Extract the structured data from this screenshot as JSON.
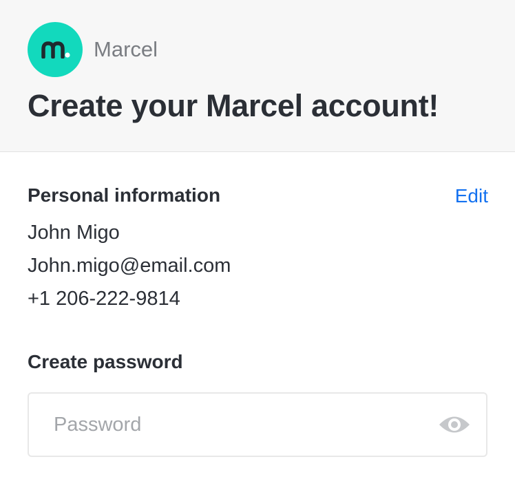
{
  "header": {
    "brand_name": "Marcel",
    "title": "Create your Marcel account!"
  },
  "personal_info": {
    "heading": "Personal information",
    "edit_label": "Edit",
    "name": "John Migo",
    "email": "John.migo@email.com",
    "phone": "+1 206-222-9814"
  },
  "password": {
    "heading": "Create password",
    "placeholder": "Password",
    "value": ""
  },
  "icons": {
    "logo": "marcel-logo-icon",
    "toggle": "eye-icon"
  },
  "colors": {
    "brand": "#12d9bd",
    "link": "#1371f0",
    "text": "#2b2f36",
    "muted": "#7a7d82",
    "header_bg": "#f7f7f7"
  }
}
